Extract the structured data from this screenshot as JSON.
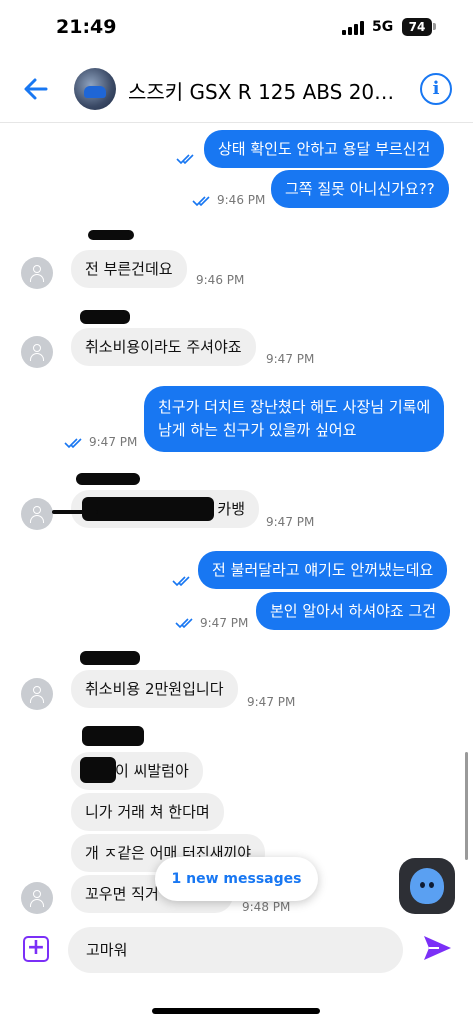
{
  "status": {
    "time": "21:49",
    "network": "5G",
    "battery": "74"
  },
  "header": {
    "title": "스즈키 GSX R 125 ABS 2019..."
  },
  "messages": [
    {
      "text": "상태 확인도 안하고 용달 부르신건"
    },
    {
      "text": "그쪽 질못 아니신가요??",
      "time": "9:46 PM"
    },
    {
      "text": "전 부른건데요",
      "time": "9:46 PM"
    },
    {
      "text": "취소비용이라도 주셔야죠",
      "time": "9:47 PM"
    },
    {
      "line1": "친구가 더치트 장난쳤다 해도 사장님 기록에",
      "line2": "남게 하는 친구가 있을까 싶어요",
      "time": "9:47 PM"
    },
    {
      "text": "카뱅",
      "time": "9:47 PM"
    },
    {
      "text": "전 불러달라고 얘기도 안꺼냈는데요"
    },
    {
      "text": "본인 알아서 하셔야죠 그건",
      "time": "9:47 PM"
    },
    {
      "text": "취소비용 2만원입니다",
      "time": "9:47 PM"
    },
    {
      "text": "이 씨발럼아"
    },
    {
      "text": "니가 거래 쳐 한다며"
    },
    {
      "text": "개 ㅈ같은 어매 터진새끼야"
    },
    {
      "text": "꼬우면 직거",
      "time": "9:48 PM"
    }
  ],
  "new_messages": "1 new messages",
  "composer": {
    "value": "고마워"
  },
  "colors": {
    "accent": "#1877f2",
    "outgoing_bubble": "#1877f2",
    "incoming_bubble": "#efefef",
    "composer_icons": "#7b2ff7"
  },
  "icons": [
    "back-arrow-icon",
    "info-icon",
    "double-check-icon",
    "avatar-placeholder-icon",
    "add-media-icon",
    "send-icon",
    "ai-assistant-icon"
  ]
}
